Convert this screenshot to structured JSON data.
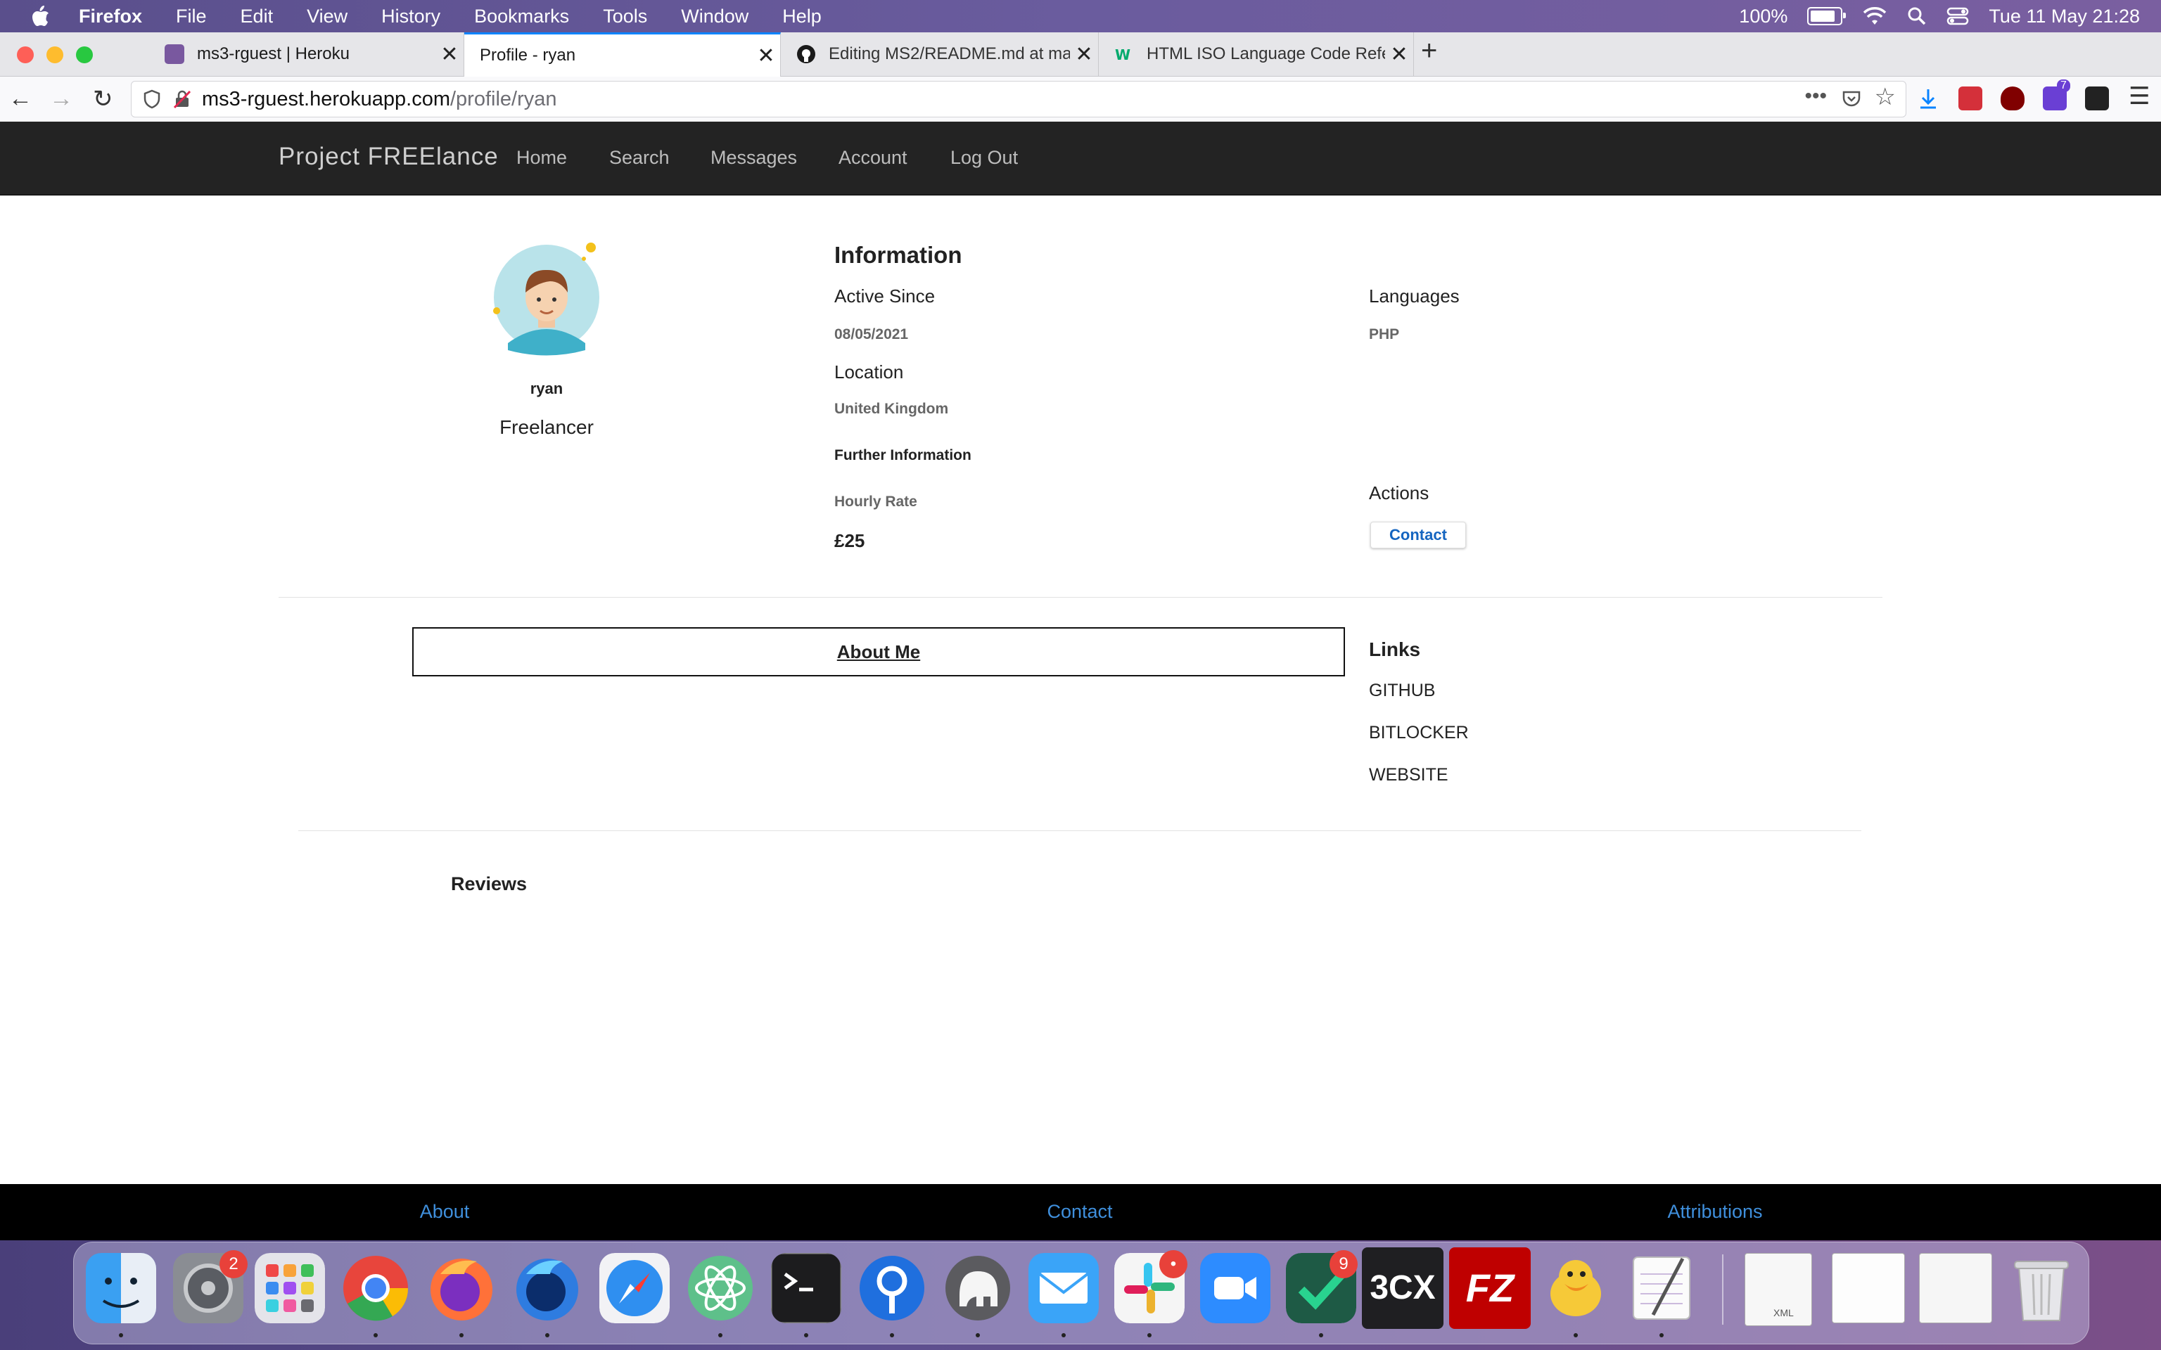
{
  "menubar": {
    "app_name": "Firefox",
    "menus": [
      "File",
      "Edit",
      "View",
      "History",
      "Bookmarks",
      "Tools",
      "Window",
      "Help"
    ],
    "battery_percent": "100%",
    "datetime": "Tue 11 May  21:28"
  },
  "browser": {
    "tabs": [
      {
        "title": "ms3-rguest | Heroku",
        "active": false
      },
      {
        "title": "Profile - ryan",
        "active": true
      },
      {
        "title": "Editing MS2/README.md at ma",
        "active": false
      },
      {
        "title": "HTML ISO Language Code Refe",
        "active": false
      }
    ],
    "url_domain": "ms3-rguest.herokuapp.com",
    "url_path": "/profile/ryan",
    "extension_badge": "7"
  },
  "site": {
    "brand": "Project FREElance",
    "nav": [
      "Home",
      "Search",
      "Messages",
      "Account",
      "Log Out"
    ]
  },
  "profile": {
    "username": "ryan",
    "role": "Freelancer",
    "information_heading": "Information",
    "active_since_label": "Active Since",
    "active_since_value": "08/05/2021",
    "location_label": "Location",
    "location_value": "United Kingdom",
    "further_info_label": "Further Information",
    "hourly_rate_label": "Hourly Rate",
    "hourly_rate_value": "£25",
    "languages_label": "Languages",
    "languages_value": "PHP",
    "actions_label": "Actions",
    "contact_button": "Contact",
    "about_me": "About Me",
    "links_heading": "Links",
    "links": [
      "GITHUB",
      "BITLOCKER",
      "WEBSITE"
    ],
    "reviews_heading": "Reviews"
  },
  "footer": {
    "links": [
      "About",
      "Contact",
      "Attributions"
    ]
  },
  "dock": {
    "badges": {
      "system_preferences": "2",
      "slack": "•",
      "tick_app": "9"
    },
    "app_3cx_label": "3CX",
    "app_filezilla_label": "FZ",
    "doc_label": "XML"
  },
  "colors": {
    "nav_bg": "#232323",
    "footer_link": "#3f8fdc",
    "contact_text": "#1565c0",
    "tab_accent": "#0a84ff"
  }
}
